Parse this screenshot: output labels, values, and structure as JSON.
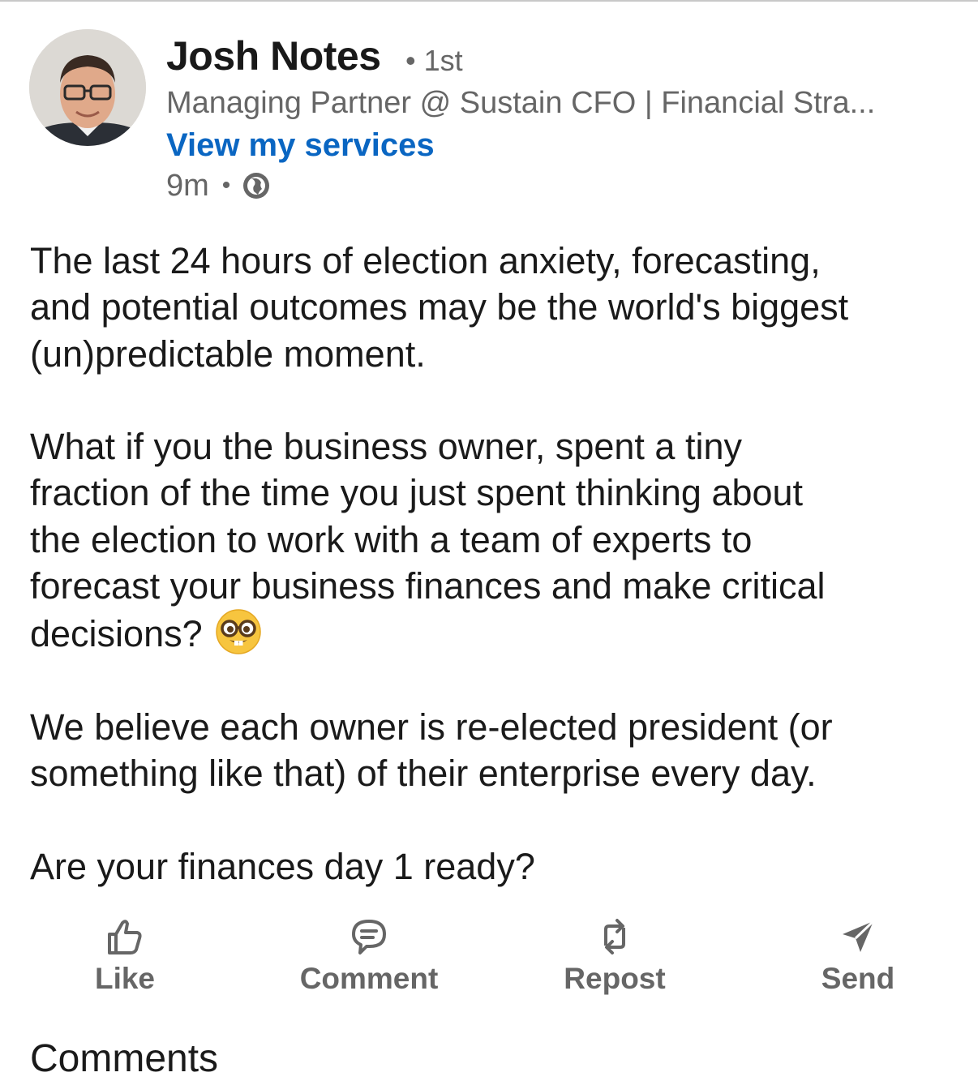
{
  "post": {
    "author": {
      "name": "Josh Notes",
      "degree_dot": "•",
      "degree": "1st",
      "headline": "Managing Partner @ Sustain CFO | Financial Stra...",
      "services_link": "View my services",
      "time_ago": "9m",
      "meta_separator": "•",
      "visibility_icon": "globe-icon",
      "avatar_icon": "profile-photo"
    },
    "body": {
      "paragraph1_line1": "The last 24 hours of election anxiety, forecasting,",
      "paragraph1_line2": "and potential outcomes may be the world's biggest",
      "paragraph1_line3": "(un)predictable moment.",
      "paragraph2_line1": "What if you the business owner, spent a tiny",
      "paragraph2_line2": "fraction of the time you just spent thinking about",
      "paragraph2_line3": "the election to work with a team of experts to",
      "paragraph2_line4": "forecast your business finances and make critical",
      "paragraph2_line5": "decisions?",
      "emoji": "nerd-face-emoji",
      "paragraph3_line1": "We believe each owner is re-elected president (or",
      "paragraph3_line2": "something like that) of their enterprise every day.",
      "paragraph4_line1": "Are your finances day 1 ready?"
    },
    "actions": {
      "like": {
        "label": "Like",
        "icon": "thumbs-up-icon"
      },
      "comment": {
        "label": "Comment",
        "icon": "comment-bubble-icon"
      },
      "repost": {
        "label": "Repost",
        "icon": "repost-icon"
      },
      "send": {
        "label": "Send",
        "icon": "send-icon"
      }
    }
  },
  "comments": {
    "heading": "Comments"
  },
  "colors": {
    "link": "#0a66c2",
    "secondary_text": "#666666",
    "primary_text": "#1a1a1a"
  }
}
